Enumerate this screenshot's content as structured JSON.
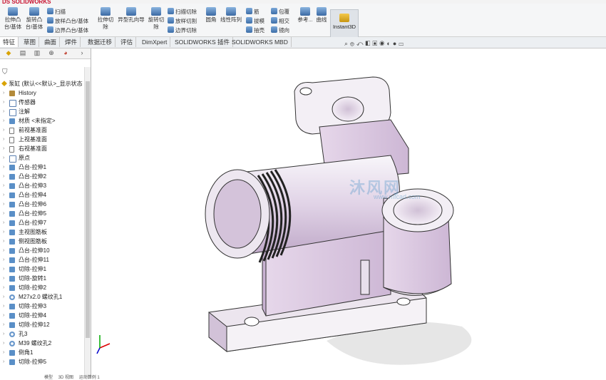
{
  "app": {
    "logo": "DS SOLIDWORKS"
  },
  "ribbon": {
    "groups": [
      {
        "label1": "拉伸凸",
        "label2": "台/基体"
      },
      {
        "label1": "旋转凸",
        "label2": "台/基体"
      },
      {
        "label1": "扫描"
      },
      {
        "label1": "放样凸台/基体"
      },
      {
        "label1": "边界凸台/基体"
      },
      {
        "label1": "拉伸切",
        "label2": "除"
      },
      {
        "label1": "异型孔向导"
      },
      {
        "label1": "旋转切",
        "label2": "除"
      },
      {
        "label1": "扫描切除"
      },
      {
        "label1": "放样切割"
      },
      {
        "label1": "边界切除"
      },
      {
        "label1": "圆角"
      },
      {
        "label1": "线性阵列"
      },
      {
        "label1": "筋"
      },
      {
        "label1": "拔模"
      },
      {
        "label1": "抽壳"
      },
      {
        "label1": "包覆"
      },
      {
        "label1": "相交"
      },
      {
        "label1": "镜向"
      },
      {
        "label1": "参考..."
      },
      {
        "label1": "曲线"
      }
    ],
    "instant3d": "Instant3D"
  },
  "tabs": [
    "特征",
    "草图",
    "曲面",
    "焊件",
    "数据迁移",
    "评估",
    "DimXpert",
    "SOLIDWORKS 插件",
    "SOLIDWORKS MBD"
  ],
  "panel": {
    "root": "泵缸 (默认<<默认>_显示状态",
    "items": [
      {
        "label": "History",
        "icon": "history-icon"
      },
      {
        "label": "传感器",
        "icon": "sensor-icon"
      },
      {
        "label": "注解",
        "icon": "annotation-icon"
      },
      {
        "label": "材质 <未指定>",
        "icon": "material-icon"
      },
      {
        "label": "前视基准面",
        "icon": "plane-icon"
      },
      {
        "label": "上视基准面",
        "icon": "plane-icon"
      },
      {
        "label": "右视基准面",
        "icon": "plane-icon"
      },
      {
        "label": "原点",
        "icon": "origin-icon"
      },
      {
        "label": "凸台-拉伸1",
        "icon": "extrude-icon"
      },
      {
        "label": "凸台-拉伸2",
        "icon": "extrude-icon"
      },
      {
        "label": "凸台-拉伸3",
        "icon": "extrude-icon"
      },
      {
        "label": "凸台-拉伸4",
        "icon": "extrude-icon"
      },
      {
        "label": "凸台-拉伸6",
        "icon": "extrude-icon"
      },
      {
        "label": "凸台-拉伸5",
        "icon": "extrude-icon"
      },
      {
        "label": "凸台-拉伸7",
        "icon": "extrude-icon"
      },
      {
        "label": "主视图筋板",
        "icon": "rib-icon"
      },
      {
        "label": "侧视图筋板",
        "icon": "rib-icon"
      },
      {
        "label": "凸台-拉伸10",
        "icon": "extrude-icon"
      },
      {
        "label": "凸台-拉伸11",
        "icon": "extrude-icon"
      },
      {
        "label": "切除-拉伸1",
        "icon": "cut-icon"
      },
      {
        "label": "切除-旋转1",
        "icon": "cut-icon"
      },
      {
        "label": "切除-拉伸2",
        "icon": "cut-icon"
      },
      {
        "label": "M27x2.0 螺纹孔1",
        "icon": "hole-icon"
      },
      {
        "label": "切除-拉伸3",
        "icon": "cut-icon"
      },
      {
        "label": "切除-拉伸4",
        "icon": "cut-icon"
      },
      {
        "label": "切除-拉伸12",
        "icon": "cut-icon"
      },
      {
        "label": "孔3",
        "icon": "hole-icon"
      },
      {
        "label": "M39 螺纹孔2",
        "icon": "hole-icon"
      },
      {
        "label": "倒角1",
        "icon": "chamfer-icon"
      },
      {
        "label": "切除-拉伸5",
        "icon": "cut-icon"
      }
    ]
  },
  "bottom_tabs": [
    "模型",
    "3D 视图",
    "运动算例 1"
  ],
  "watermark": {
    "text": "沐风网",
    "url": "www.mfcad.com"
  },
  "colors": {
    "part": "#d9c8de",
    "accent": "#c8102e"
  }
}
